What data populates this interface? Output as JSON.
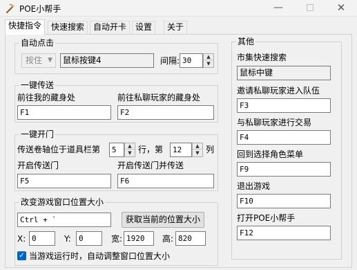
{
  "window": {
    "title": "POE小帮手",
    "minimize": "—",
    "close": "✕"
  },
  "tabs": [
    "快捷指令",
    "快速搜索",
    "自动开卡",
    "设置",
    "关于"
  ],
  "auto_click": {
    "title": "自动点击",
    "key_dropdown": "按住",
    "key_value": "鼠标按键4",
    "interval_label": "间隔:",
    "interval_value": "30"
  },
  "teleport": {
    "title": "一键传送",
    "hideout_label": "前往我的藏身处",
    "hideout_key": "F1",
    "private_hideout_label": "前往私聊玩家的藏身处",
    "private_hideout_key": "F2"
  },
  "portal": {
    "title": "一键开门",
    "scroll_label": "传送卷轴位于道具栏第",
    "row_value": "5",
    "row_label": "行，第",
    "col_value": "12",
    "col_label": "列",
    "open_label": "开启传送门",
    "open_key": "F5",
    "open_tp_label": "开启传送门并传送",
    "open_tp_key": "F6"
  },
  "window_pos": {
    "title": "改变游戏窗口位置大小",
    "hotkey": "Ctrl + `",
    "get_button": "获取当前的位置大小",
    "x_label": "X:",
    "x_value": "0",
    "y_label": "Y:",
    "y_value": "0",
    "w_label": "宽:",
    "w_value": "1920",
    "h_label": "高:",
    "h_value": "820",
    "auto_adjust_label": "当游戏运行时，自动调整窗口位置大小",
    "auto_adjust_checked": true
  },
  "other": {
    "title": "其他",
    "market_label": "市集快速搜索",
    "market_key": "鼠标中键",
    "invite_label": "邀请私聊玩家进入队伍",
    "invite_key": "F3",
    "trade_label": "与私聊玩家进行交易",
    "trade_key": "F4",
    "char_select_label": "回到选择角色菜单",
    "char_select_key": "F9",
    "exit_label": "退出游戏",
    "exit_key": "F10",
    "open_app_label": "打开POE小帮手",
    "open_app_key": "F12"
  },
  "colors": {
    "accent": "#0067c0",
    "window_bg": "#f0f0f0"
  }
}
